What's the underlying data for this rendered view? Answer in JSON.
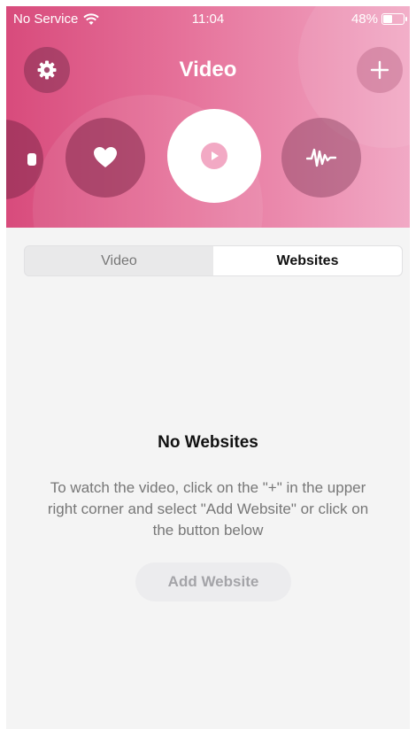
{
  "status": {
    "carrier": "No Service",
    "time": "11:04",
    "battery": "48%"
  },
  "header": {
    "title": "Video"
  },
  "tabs": [
    {
      "label": "Video"
    },
    {
      "label": "Websites"
    }
  ],
  "selected_tab": "Websites",
  "empty_state": {
    "title": "No Websites",
    "description": "To watch the video, click on the \"+\" in the upper right corner and select \"Add Website\" or click on the button below",
    "button_label": "Add Website"
  },
  "icons": {
    "settings": "gear-icon",
    "add": "plus-icon",
    "favorites": "heart-icon",
    "play": "play-icon",
    "audio": "waveform-icon"
  },
  "colors": {
    "accent_start": "#d84b7c",
    "accent_end": "#f1a9c5",
    "background": "#f4f4f4"
  }
}
